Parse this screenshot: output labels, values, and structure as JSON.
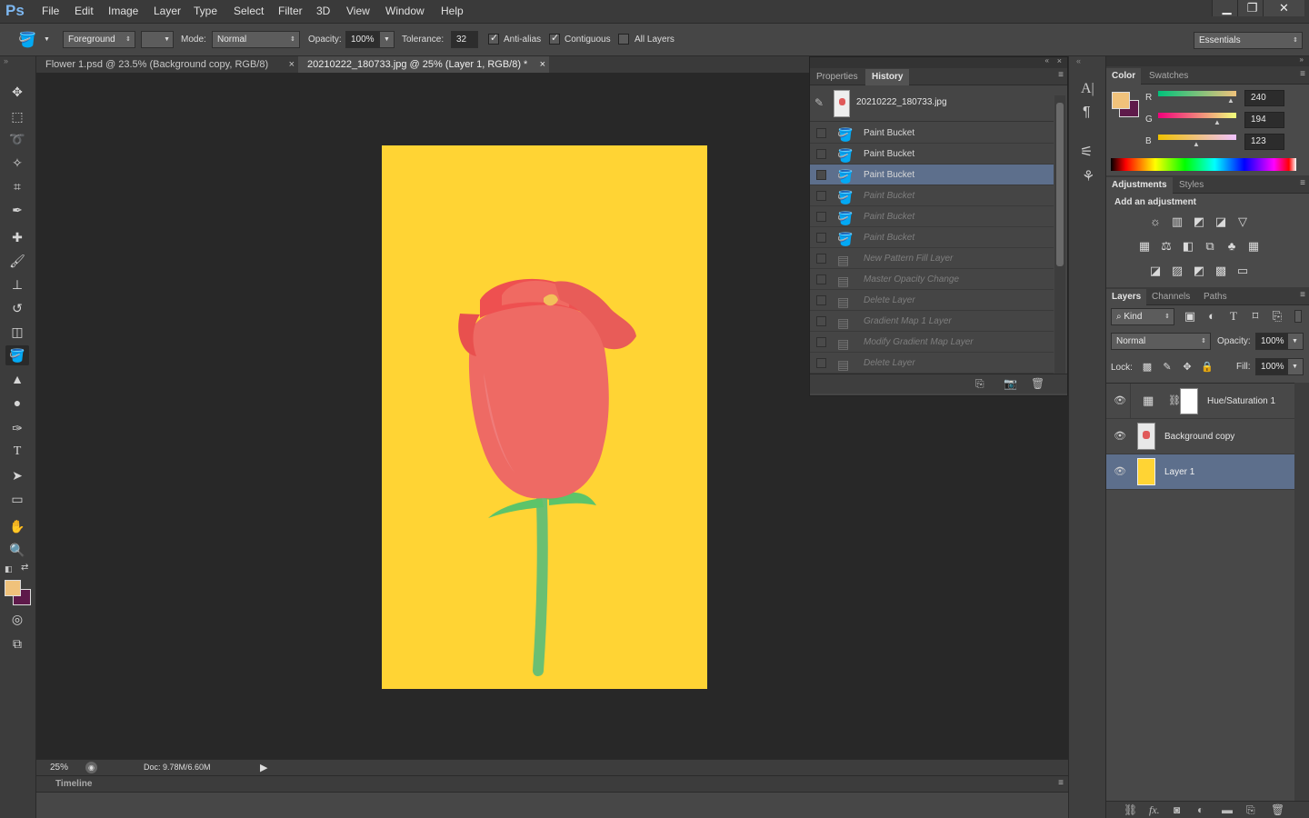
{
  "app": {
    "logo": "Ps"
  },
  "menu": [
    "File",
    "Edit",
    "Image",
    "Layer",
    "Type",
    "Select",
    "Filter",
    "3D",
    "View",
    "Window",
    "Help"
  ],
  "window_controls": {
    "minimize": "▁",
    "restore": "❐",
    "close": "✕"
  },
  "options": {
    "fill_source": "Foreground",
    "mode_label": "Mode:",
    "mode_value": "Normal",
    "opacity_label": "Opacity:",
    "opacity_value": "100%",
    "tolerance_label": "Tolerance:",
    "tolerance_value": "32",
    "antialias_label": "Anti-alias",
    "antialias_checked": true,
    "contiguous_label": "Contiguous",
    "contiguous_checked": true,
    "all_layers_label": "All Layers",
    "all_layers_checked": false,
    "workspace": "Essentials"
  },
  "tabs": [
    {
      "label": "Flower 1.psd @ 23.5% (Background copy, RGB/8)",
      "active": false
    },
    {
      "label": "20210222_180733.jpg @ 25% (Layer 1, RGB/8) *",
      "active": true
    }
  ],
  "status": {
    "zoom": "25%",
    "doc": "Doc: 9.78M/6.60M"
  },
  "timeline": {
    "label": "Timeline"
  },
  "history": {
    "tabs": [
      "Properties",
      "History"
    ],
    "snapshot": "20210222_180733.jpg",
    "items": [
      {
        "label": "Paint Bucket",
        "state": "normal"
      },
      {
        "label": "Paint Bucket",
        "state": "normal"
      },
      {
        "label": "Paint Bucket",
        "state": "selected"
      },
      {
        "label": "Paint Bucket",
        "state": "dim"
      },
      {
        "label": "Paint Bucket",
        "state": "dim"
      },
      {
        "label": "Paint Bucket",
        "state": "dim"
      },
      {
        "label": "New Pattern Fill Layer",
        "state": "dim"
      },
      {
        "label": "Master Opacity Change",
        "state": "dim"
      },
      {
        "label": "Delete Layer",
        "state": "dim"
      },
      {
        "label": "Gradient Map 1 Layer",
        "state": "dim"
      },
      {
        "label": "Modify Gradient Map Layer",
        "state": "dim"
      },
      {
        "label": "Delete Layer",
        "state": "dim"
      }
    ]
  },
  "color_panel": {
    "tabs": [
      "Color",
      "Swatches"
    ],
    "r_label": "R",
    "r_value": "240",
    "g_label": "G",
    "g_value": "194",
    "b_label": "B",
    "b_value": "123",
    "foreground": "#f0c27b",
    "background": "#5e1a4a"
  },
  "adjustments": {
    "tabs": [
      "Adjustments",
      "Styles"
    ],
    "heading": "Add an adjustment"
  },
  "layers_panel": {
    "tabs": [
      "Layers",
      "Channels",
      "Paths"
    ],
    "kind_label": "Kind",
    "blend_mode": "Normal",
    "opacity_label": "Opacity:",
    "opacity_value": "100%",
    "lock_label": "Lock:",
    "fill_label": "Fill:",
    "fill_value": "100%",
    "layers": [
      {
        "name": "Hue/Saturation 1",
        "selected": false
      },
      {
        "name": "Background copy",
        "selected": false
      },
      {
        "name": "Layer 1",
        "selected": true
      }
    ]
  },
  "colors": {
    "canvas_fill": "#ffd434",
    "selection": "#5d6f8c"
  }
}
